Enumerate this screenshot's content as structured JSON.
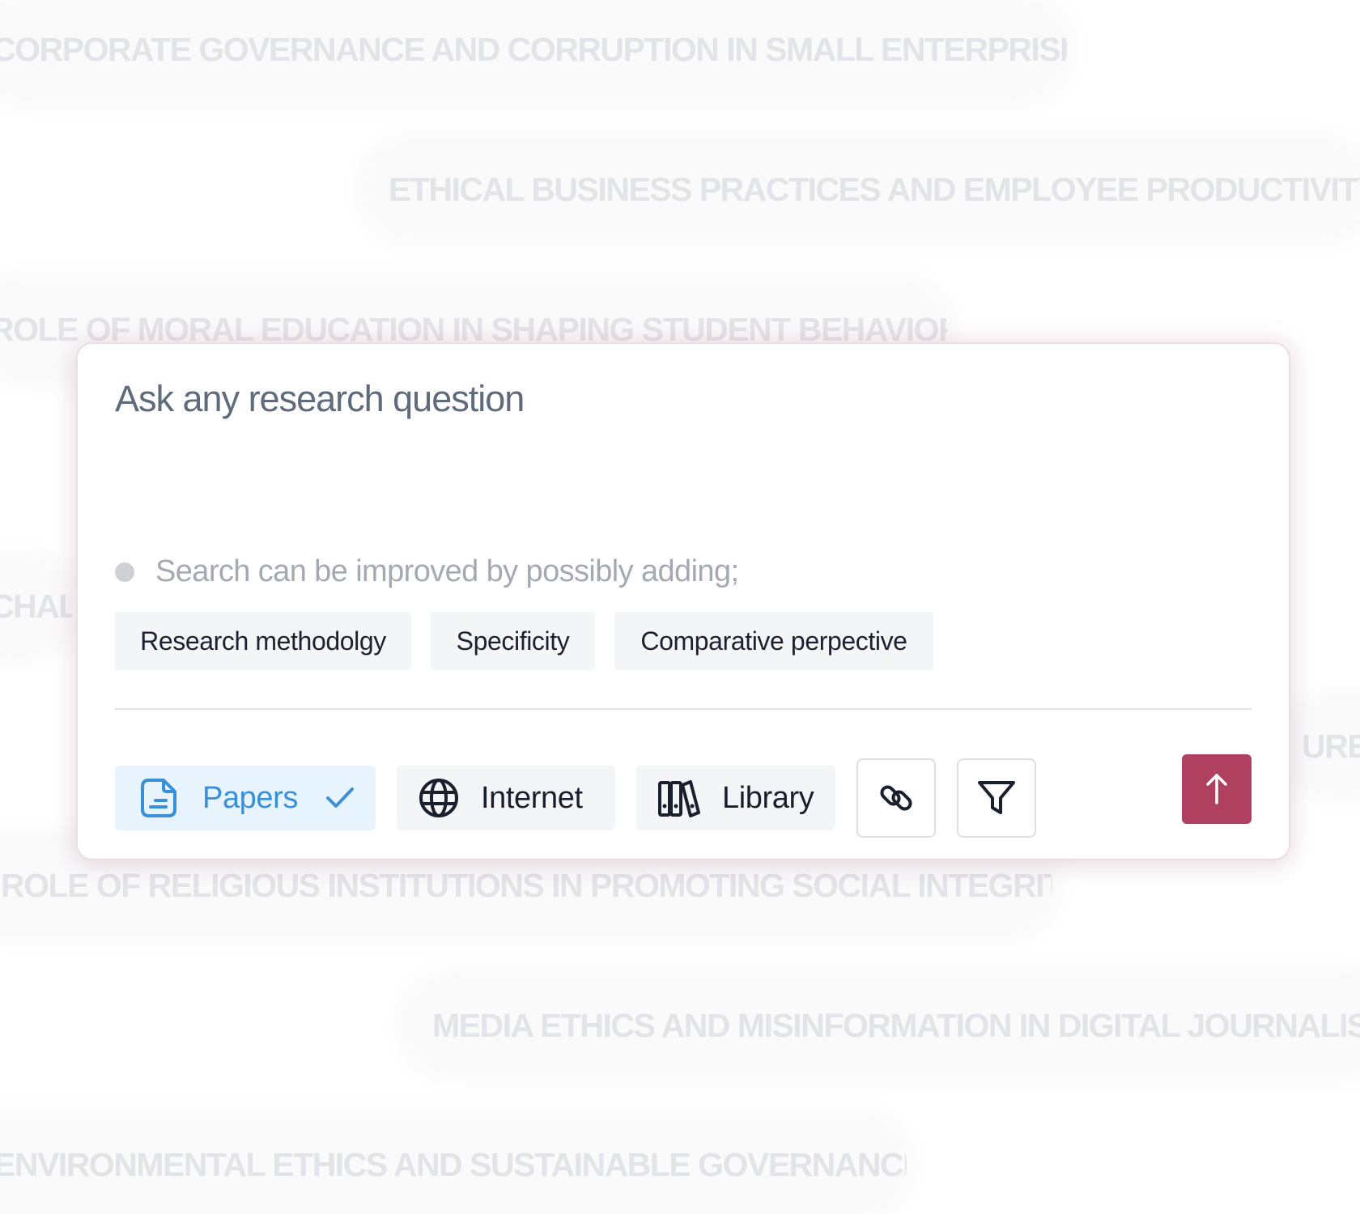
{
  "background_topics": [
    "CORPORATE GOVERNANCE AND CORRUPTION IN SMALL ENTERPRISES",
    "ETHICAL BUSINESS PRACTICES AND EMPLOYEE PRODUCTIVITY",
    "ROLE OF MORAL EDUCATION IN SHAPING STUDENT BEHAVIOR",
    "CHAL",
    "URES",
    "ROLE OF RELIGIOUS INSTITUTIONS IN PROMOTING SOCIAL INTEGRITY",
    "MEDIA ETHICS AND MISINFORMATION IN DIGITAL JOURNALISM",
    "ENVIRONMENTAL ETHICS AND SUSTAINABLE GOVERNANCE"
  ],
  "search": {
    "placeholder": "Ask any research question",
    "hint": "Search can be improved by possibly adding;",
    "suggestions": [
      "Research methodolgy",
      "Specificity",
      "Comparative perpective"
    ]
  },
  "sources": {
    "papers": {
      "label": "Papers",
      "selected": true,
      "icon": "paper-icon"
    },
    "internet": {
      "label": "Internet",
      "selected": false,
      "icon": "globe-icon"
    },
    "library": {
      "label": "Library",
      "selected": false,
      "icon": "books-icon"
    }
  },
  "actions": {
    "attach_icon": "link-icon",
    "filter_icon": "filter-icon",
    "send_icon": "arrow-up-icon"
  },
  "colors": {
    "accent": "#b0405f",
    "selected_text": "#3a8fd9",
    "selected_bg": "#e8f4fd",
    "placeholder_text": "#5f6a7b",
    "background_text": "#e3e4e8"
  }
}
